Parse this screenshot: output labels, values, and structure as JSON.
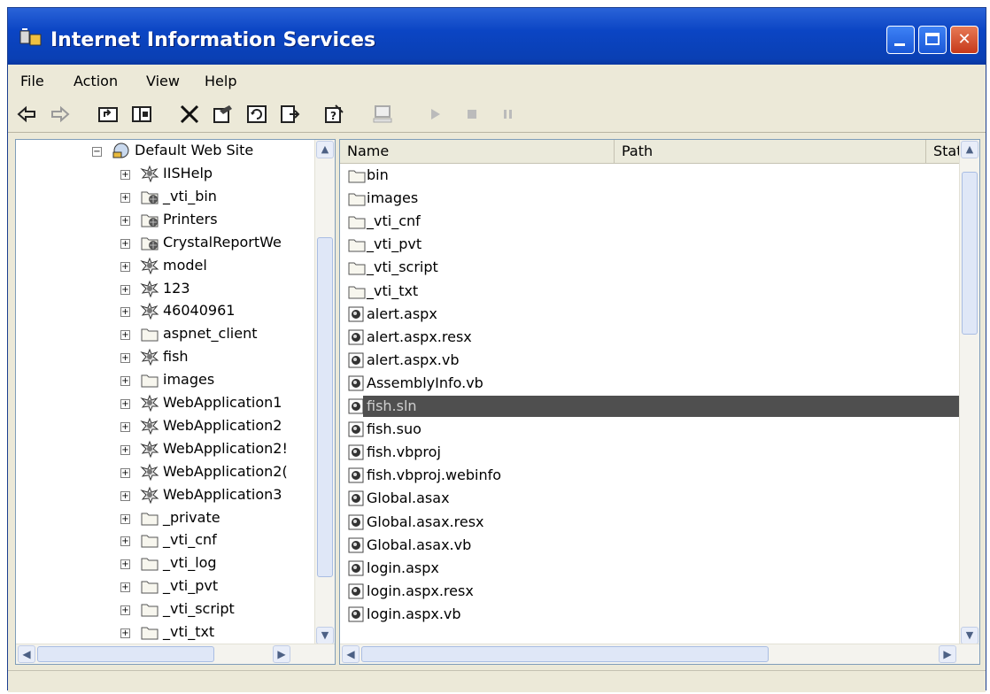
{
  "window": {
    "title": "Internet Information Services"
  },
  "menu": [
    "File",
    "Action",
    "View",
    "Help"
  ],
  "toolbar": {
    "buttons": [
      {
        "icon": "back-arrow-icon"
      },
      {
        "icon": "forward-arrow-icon"
      },
      {
        "icon": "up-folder-icon"
      },
      {
        "icon": "show-hide-tree-icon"
      },
      {
        "icon": "delete-icon"
      },
      {
        "icon": "properties-icon"
      },
      {
        "icon": "refresh-icon"
      },
      {
        "icon": "export-list-icon"
      },
      {
        "icon": "help-icon"
      },
      {
        "icon": "computer-icon"
      },
      {
        "icon": "start-icon"
      },
      {
        "icon": "stop-icon"
      },
      {
        "icon": "pause-icon"
      }
    ]
  },
  "tree": {
    "root": "Default Web Site",
    "items": [
      {
        "label": "IISHelp",
        "icon": "web-app-icon"
      },
      {
        "label": "_vti_bin",
        "icon": "virtual-dir-icon"
      },
      {
        "label": "Printers",
        "icon": "virtual-dir-icon"
      },
      {
        "label": "CrystalReportWe",
        "icon": "virtual-dir-icon"
      },
      {
        "label": "model",
        "icon": "web-app-icon"
      },
      {
        "label": "123",
        "icon": "web-app-icon"
      },
      {
        "label": "46040961",
        "icon": "web-app-icon"
      },
      {
        "label": "aspnet_client",
        "icon": "folder-icon"
      },
      {
        "label": "fish",
        "icon": "web-app-icon"
      },
      {
        "label": "images",
        "icon": "folder-icon"
      },
      {
        "label": "WebApplication1",
        "icon": "web-app-icon"
      },
      {
        "label": "WebApplication2",
        "icon": "web-app-icon"
      },
      {
        "label": "WebApplication2!",
        "icon": "web-app-icon"
      },
      {
        "label": "WebApplication2(",
        "icon": "web-app-icon"
      },
      {
        "label": "WebApplication3",
        "icon": "web-app-icon"
      },
      {
        "label": "_private",
        "icon": "folder-icon"
      },
      {
        "label": "_vti_cnf",
        "icon": "folder-icon"
      },
      {
        "label": "_vti_log",
        "icon": "folder-icon"
      },
      {
        "label": "_vti_pvt",
        "icon": "folder-icon"
      },
      {
        "label": "_vti_script",
        "icon": "folder-icon"
      },
      {
        "label": "_vti_txt",
        "icon": "folder-icon"
      }
    ]
  },
  "list": {
    "columns": [
      "Name",
      "Path",
      "Statu"
    ],
    "rows": [
      {
        "name": "bin",
        "icon": "folder-icon",
        "selected": false
      },
      {
        "name": "images",
        "icon": "folder-icon",
        "selected": false
      },
      {
        "name": "_vti_cnf",
        "icon": "folder-icon",
        "selected": false
      },
      {
        "name": "_vti_pvt",
        "icon": "folder-icon",
        "selected": false
      },
      {
        "name": "_vti_script",
        "icon": "folder-icon",
        "selected": false
      },
      {
        "name": "_vti_txt",
        "icon": "folder-icon",
        "selected": false
      },
      {
        "name": "alert.aspx",
        "icon": "file-icon",
        "selected": false
      },
      {
        "name": "alert.aspx.resx",
        "icon": "file-icon",
        "selected": false
      },
      {
        "name": "alert.aspx.vb",
        "icon": "file-icon",
        "selected": false
      },
      {
        "name": "AssemblyInfo.vb",
        "icon": "file-icon",
        "selected": false
      },
      {
        "name": "fish.sln",
        "icon": "file-icon",
        "selected": true
      },
      {
        "name": "fish.suo",
        "icon": "file-icon",
        "selected": false
      },
      {
        "name": "fish.vbproj",
        "icon": "file-icon",
        "selected": false
      },
      {
        "name": "fish.vbproj.webinfo",
        "icon": "file-icon",
        "selected": false
      },
      {
        "name": "Global.asax",
        "icon": "file-icon",
        "selected": false
      },
      {
        "name": "Global.asax.resx",
        "icon": "file-icon",
        "selected": false
      },
      {
        "name": "Global.asax.vb",
        "icon": "file-icon",
        "selected": false
      },
      {
        "name": "login.aspx",
        "icon": "file-icon",
        "selected": false
      },
      {
        "name": "login.aspx.resx",
        "icon": "file-icon",
        "selected": false
      },
      {
        "name": "login.aspx.vb",
        "icon": "file-icon",
        "selected": false
      }
    ]
  },
  "colors": {
    "title_bar": "#0b45c4",
    "selection": "#4f4f4f",
    "chrome": "#ece9d8"
  }
}
